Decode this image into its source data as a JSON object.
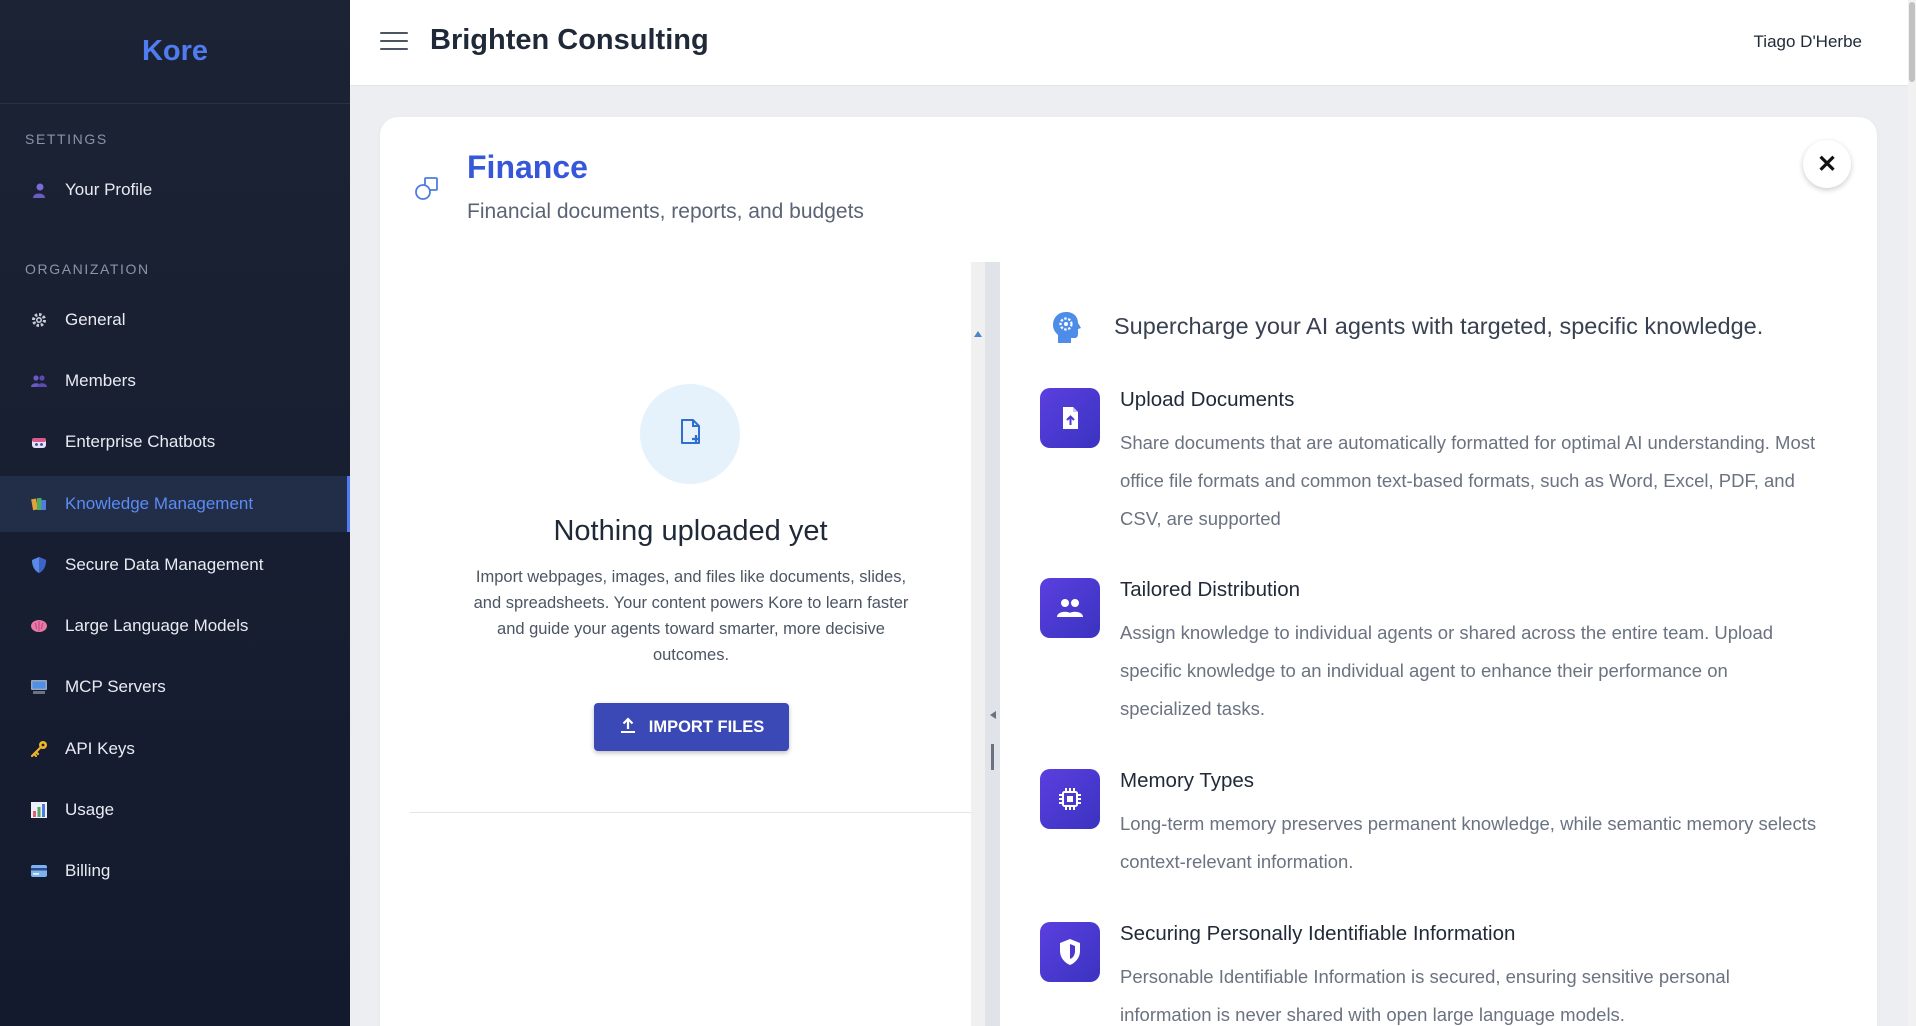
{
  "sidebar": {
    "brand": "Kore",
    "settings_label": "SETTINGS",
    "organization_label": "ORGANIZATION",
    "profile": {
      "label": "Your Profile",
      "icon": "person-icon"
    },
    "items": [
      {
        "label": "General",
        "icon": "gear-icon"
      },
      {
        "label": "Members",
        "icon": "people-icon"
      },
      {
        "label": "Enterprise Chatbots",
        "icon": "robot-icon"
      },
      {
        "label": "Knowledge Management",
        "icon": "books-icon",
        "active": true
      },
      {
        "label": "Secure Data Management",
        "icon": "shield-icon"
      },
      {
        "label": "Large Language Models",
        "icon": "brain-icon"
      },
      {
        "label": "MCP Servers",
        "icon": "computer-icon"
      },
      {
        "label": "API Keys",
        "icon": "key-icon"
      },
      {
        "label": "Usage",
        "icon": "bar-chart-icon"
      },
      {
        "label": "Billing",
        "icon": "credit-card-icon"
      }
    ]
  },
  "header": {
    "company": "Brighten Consulting",
    "user": "Tiago D'Herbe"
  },
  "card": {
    "title": "Finance",
    "subtitle": "Financial documents, reports, and budgets",
    "close_label": "✕"
  },
  "empty_state": {
    "title": "Nothing uploaded yet",
    "description": "Import webpages, images, and files like documents, slides, and spreadsheets. Your content powers Kore to learn faster and guide your agents toward smarter, more decisive outcomes.",
    "import_label": "IMPORT FILES"
  },
  "info": {
    "tagline": "Supercharge your AI agents with targeted, specific knowledge.",
    "features": [
      {
        "title": "Upload Documents",
        "description": "Share documents that are automatically formatted for optimal AI understanding. Most office file formats and common text-based formats, such as Word, Excel, PDF, and CSV, are supported",
        "icon": "file-upload-icon"
      },
      {
        "title": "Tailored Distribution",
        "description": "Assign knowledge to individual agents or shared across the entire team. Upload specific knowledge to an individual agent to enhance their performance on specialized tasks.",
        "icon": "group-icon"
      },
      {
        "title": "Memory Types",
        "description": "Long-term memory preserves permanent knowledge, while semantic memory selects context-relevant information.",
        "icon": "chip-icon"
      },
      {
        "title": "Securing Personally Identifiable Information",
        "description": "Personable Identifiable Information is secured, ensuring sensitive personal information is never shared with open large language models.",
        "icon": "security-shield-icon"
      }
    ]
  },
  "colors": {
    "accent": "#3657d9",
    "sidebar_bg": "#1b2334",
    "button_bg": "#3b49b6",
    "feature_icon_bg": "#4a38d0"
  }
}
